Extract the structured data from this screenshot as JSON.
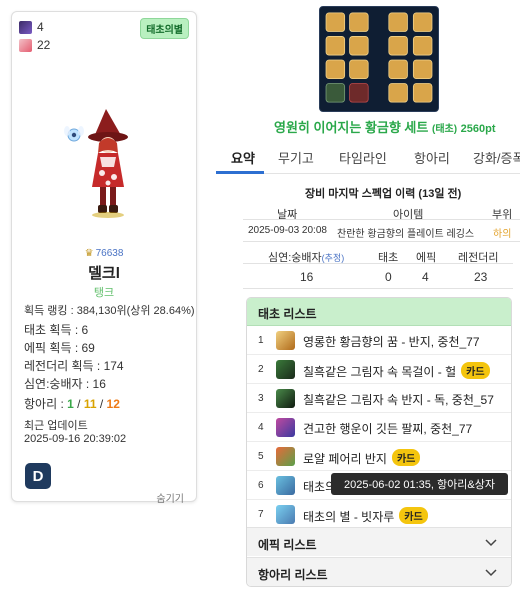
{
  "profile": {
    "stat1": "4",
    "stat2": "22",
    "badge": "태초의별",
    "fame": "76638",
    "name": "델크l",
    "class": "탱크",
    "ranking": "획득 랭킹 : 384,130위(상위 28.64%)",
    "taecho_count": "태초 획득 : 6",
    "epic_count": "에픽 획득 : 69",
    "legendary_count": "레전더리 획득 : 174",
    "abyss_count": "심연:숭배자 : 16",
    "hangari_label": "항아리 : ",
    "hangari_green": "1",
    "hangari_sep1": " / ",
    "hangari_yellow": "11",
    "hangari_sep2": " / ",
    "hangari_orange": "12",
    "update_label": "최근 업데이트",
    "update_time": "2025-09-16 20:39:02",
    "app_icon_letter": "D",
    "hide_label": "숨기기"
  },
  "set": {
    "title": "영원히 이어지는 황금향 세트",
    "subtitle": "(태초)",
    "points": "2560pt"
  },
  "tabs": [
    "요약",
    "무기고",
    "타임라인",
    "항아리",
    "강화/증폭"
  ],
  "history": {
    "title": "장비 마지막 스펙업 이력 (13일 전)",
    "headers": [
      "날짜",
      "아이템",
      "부위"
    ],
    "row": {
      "date": "2025-09-03 20:08",
      "item": "찬란한 황금향의 플레이트 레깅스",
      "slot": "하의"
    },
    "level_headers": [
      "심연:숭배자",
      "태초",
      "에픽",
      "레전더리"
    ],
    "level_note": "(추정)",
    "level_values": [
      "16",
      "0",
      "4",
      "23"
    ]
  },
  "taecho_list": {
    "header": "태초 리스트",
    "items": [
      {
        "num": "1",
        "name": "영롱한 황금향의 꿈 - 반지, 중천_77",
        "card": ""
      },
      {
        "num": "2",
        "name": "칠흑같은 그림자 속 목걸이 - 헐",
        "card": "카드"
      },
      {
        "num": "3",
        "name": "칠흑같은 그림자 속 반지 - 독, 중천_57",
        "card": ""
      },
      {
        "num": "4",
        "name": "견고한 행운이 깃든 팔찌, 중천_77",
        "card": ""
      },
      {
        "num": "5",
        "name": "로얄 페어리 반지",
        "card": "카드"
      },
      {
        "num": "6",
        "name": "태초의",
        "card": ""
      },
      {
        "num": "7",
        "name": "태초의 별 - 빗자루",
        "card": "카드"
      }
    ],
    "epic_header": "에픽 리스트",
    "hangari_header": "항아리 리스트"
  },
  "tooltip": "2025-06-02 01:35, 항아리&상자",
  "colors": {
    "accent_green": "#2aa84a",
    "tab_underline": "#2d6fd1",
    "card_badge": "#f4c50e",
    "panel_header": "#c9efcc"
  }
}
